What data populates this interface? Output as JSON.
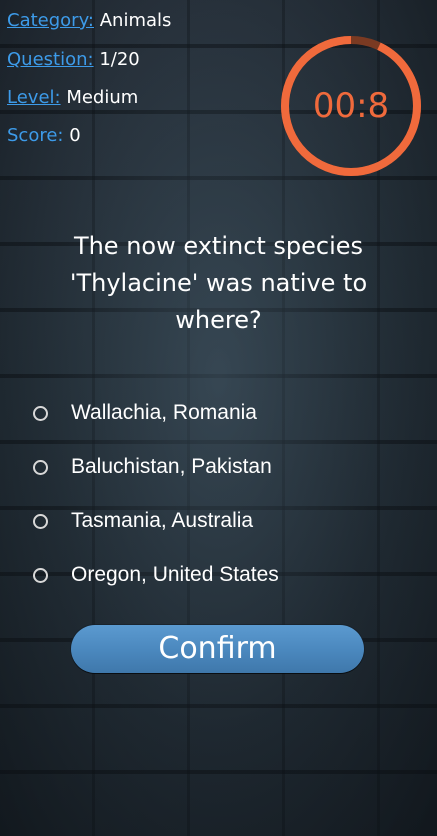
{
  "stats": {
    "category": {
      "label": "Category:",
      "value": "Animals"
    },
    "question": {
      "label": "Question:",
      "value": "1/20"
    },
    "level": {
      "label": "Level:",
      "value": "Medium"
    },
    "score": {
      "label": "Score:",
      "value": "0"
    }
  },
  "timer": {
    "text": "00:8",
    "remaining_fraction": 0.93,
    "ring_color": "#f06a3c",
    "track_color": "#7a3a22"
  },
  "question_text": "The now extinct species 'Thylacine' was native to where?",
  "options": [
    {
      "label": "Wallachia, Romania",
      "selected": false
    },
    {
      "label": "Baluchistan, Pakistan",
      "selected": false
    },
    {
      "label": "Tasmania, Australia",
      "selected": false
    },
    {
      "label": "Oregon, United States",
      "selected": false
    }
  ],
  "confirm_label": "Confirm",
  "colors": {
    "accent": "#3d9be9",
    "button": "#4a87bd",
    "timer": "#f06a3c"
  }
}
